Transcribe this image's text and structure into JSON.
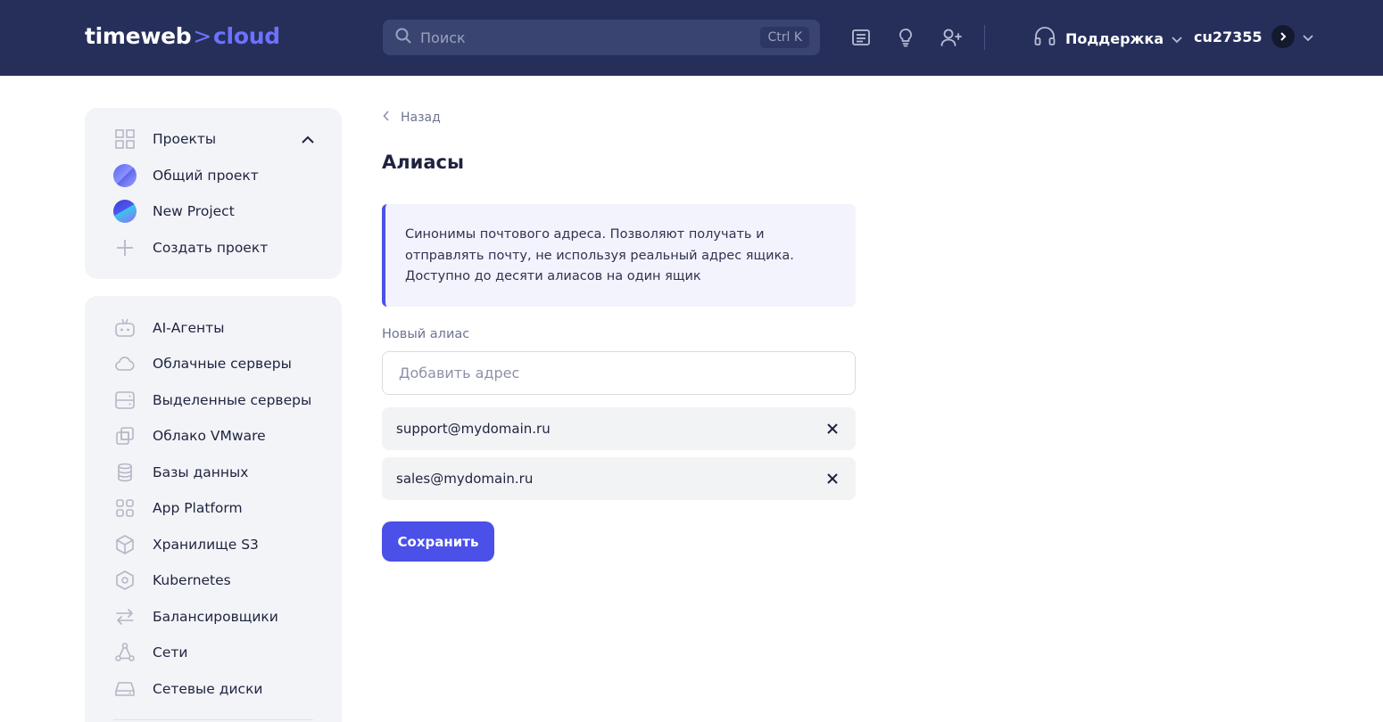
{
  "header": {
    "logo_text": "timeweb",
    "logo_arrow": ">",
    "logo_accent": "cloud",
    "search_placeholder": "Поиск",
    "search_shortcut": "Ctrl K",
    "icons": [
      "news-icon",
      "lightbulb-icon",
      "add-user-icon"
    ],
    "support_label": "Поддержка",
    "account_name": "cu27355",
    "colors": {
      "background": "#262f5a",
      "accent": "#6c72ff"
    }
  },
  "sidebar": {
    "projects": {
      "title": "Проекты",
      "items": [
        {
          "label": "Общий проект",
          "icon": "project-avatar"
        },
        {
          "label": "New Project",
          "icon": "project-avatar"
        },
        {
          "label": "Создать проект",
          "icon": "plus-icon"
        }
      ]
    },
    "services": [
      {
        "label": "AI-Агенты",
        "icon": "robot-icon"
      },
      {
        "label": "Облачные серверы",
        "icon": "cloud-icon"
      },
      {
        "label": "Выделенные серверы",
        "icon": "server-icon"
      },
      {
        "label": "Облако VMware",
        "icon": "vmware-icon"
      },
      {
        "label": "Базы данных",
        "icon": "database-icon"
      },
      {
        "label": "App Platform",
        "icon": "apps-icon"
      },
      {
        "label": "Хранилище S3",
        "icon": "cube-icon"
      },
      {
        "label": "Kubernetes",
        "icon": "kubernetes-icon"
      },
      {
        "label": "Балансировщики",
        "icon": "arrows-icon"
      },
      {
        "label": "Сети",
        "icon": "network-icon"
      },
      {
        "label": "Сетевые диски",
        "icon": "disk-icon"
      }
    ]
  },
  "main": {
    "back_label": "Назад",
    "title": "Алиасы",
    "info_text": "Синонимы почтового адреса. Позволяют получать и отправлять почту, не используя реальный адрес ящика. Доступно до десяти алиасов на один ящик",
    "new_alias_label": "Новый алиас",
    "new_alias_placeholder": "Добавить адрес",
    "new_alias_value": "",
    "aliases": [
      "support@mydomain.ru",
      "sales@mydomain.ru"
    ],
    "save_label": "Сохранить",
    "colors": {
      "primary": "#4b50e8"
    }
  }
}
